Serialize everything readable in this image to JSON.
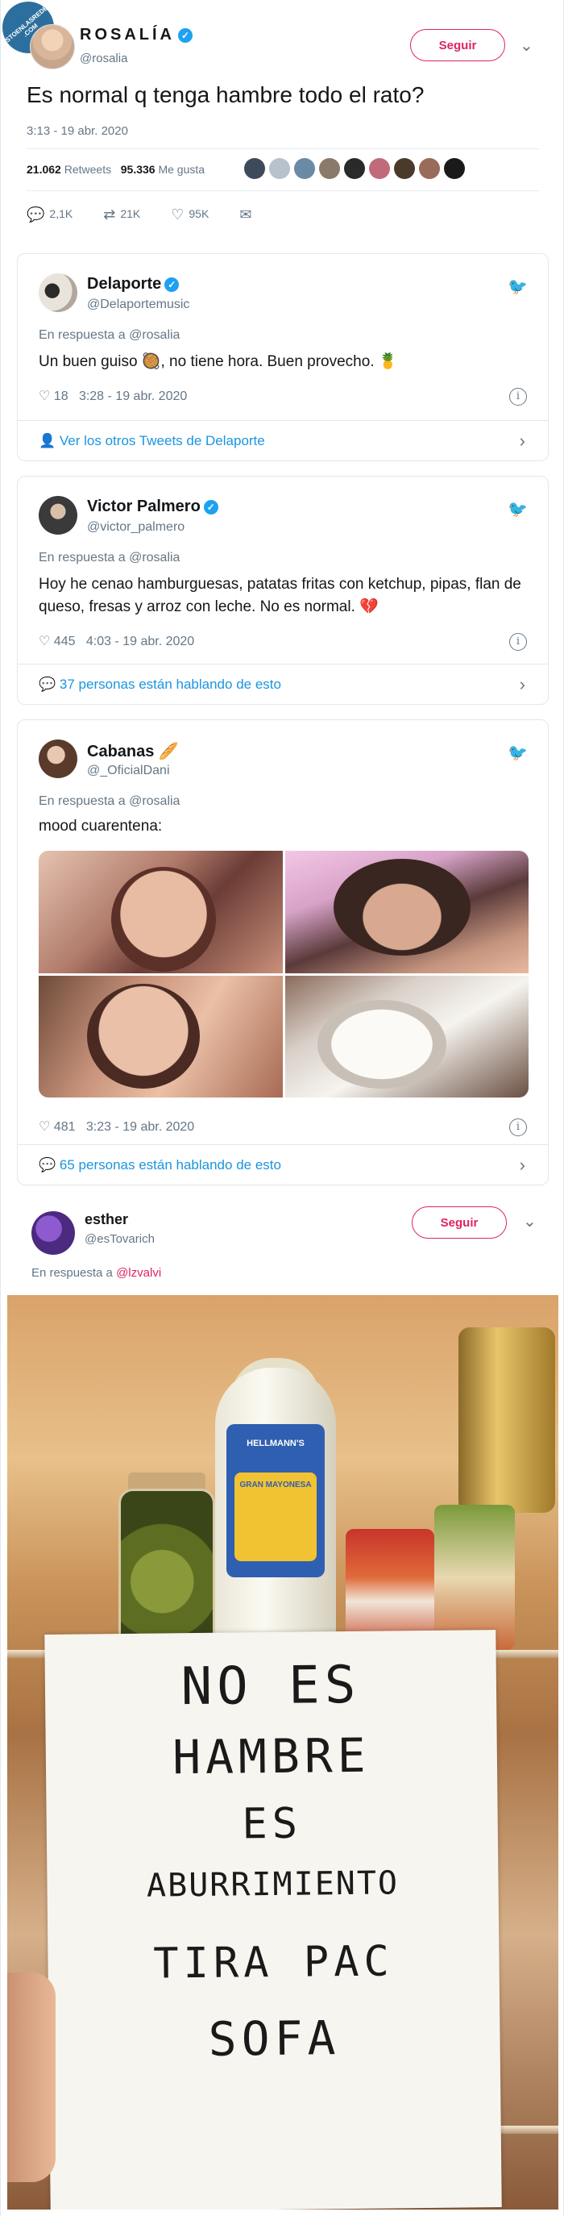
{
  "watermark": {
    "text": "VISTOENLASREDES .COM"
  },
  "main_tweet": {
    "name": "ROSALÍA",
    "handle": "@rosalia",
    "follow_label": "Seguir",
    "text": "Es normal q tenga hambre todo el rato?",
    "date": "3:13 - 19 abr. 2020",
    "retweets_count": "21.062",
    "retweets_label": "Retweets",
    "likes_count": "95.336",
    "likes_label": "Me gusta",
    "actions": {
      "replies": "2,1K",
      "retweets": "21K",
      "likes": "95K"
    }
  },
  "cards": [
    {
      "name": "Delaporte",
      "handle": "@Delaportemusic",
      "in_reply": "En respuesta a @rosalia",
      "text": "Un buen guiso 🥘, no tiene hora. Buen provecho. 🍍",
      "likes": "18",
      "time": "3:28 - 19 abr. 2020",
      "footer": "Ver los otros Tweets de Delaporte"
    },
    {
      "name": "Victor Palmero",
      "handle": "@victor_palmero",
      "in_reply": "En respuesta a @rosalia",
      "text": "Hoy he cenao hamburguesas, patatas fritas con ketchup, pipas, flan de queso, fresas y arroz con leche. No es normal. 💔",
      "likes": "445",
      "time": "4:03 - 19 abr. 2020",
      "footer": "37 personas están hablando de esto"
    },
    {
      "name": "Cabanas 🥖",
      "handle": "@_OficialDani",
      "in_reply": "En respuesta a @rosalia",
      "text": "mood cuarentena:",
      "likes": "481",
      "time": "3:23 - 19 abr. 2020",
      "footer": "65 personas están hablando de esto"
    }
  ],
  "esther": {
    "name": "esther",
    "handle": "@esTovarich",
    "follow_label": "Seguir",
    "in_reply_prefix": "En respuesta a",
    "in_reply_mention": "@lzvalvi"
  },
  "photo": {
    "mayo_brand": "HELLMANN'S",
    "mayo_product": "GRAN MAYONESA",
    "note_lines": [
      "NO ES",
      "HAMBRE",
      "ES",
      "ABURRIMIENTO",
      "TIRA PAC",
      "SOFA"
    ]
  },
  "colors": {
    "twitter_blue": "#1da1f2",
    "follow_red": "#e0245e",
    "muted": "#657786"
  }
}
